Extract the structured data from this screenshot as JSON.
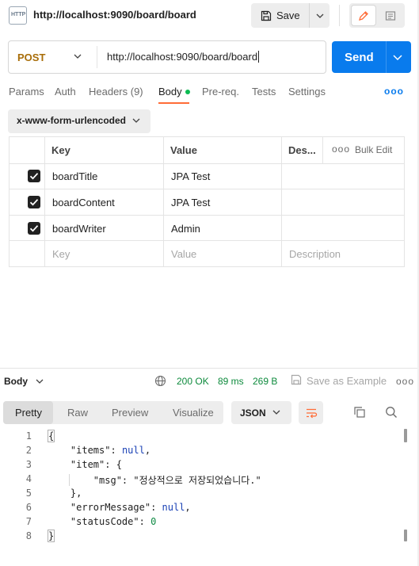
{
  "app": {
    "tab_icon_text": "HTTP",
    "tab_title": "http://localhost:9090/board/board",
    "save_label": "Save"
  },
  "request": {
    "method": "POST",
    "url": "http://localhost:9090/board/board",
    "send_label": "Send"
  },
  "request_tabs": [
    {
      "label": "Params"
    },
    {
      "label": "Auth"
    },
    {
      "label": "Headers (9)"
    },
    {
      "label": "Body",
      "active": true
    },
    {
      "label": "Pre-req."
    },
    {
      "label": "Tests"
    },
    {
      "label": "Settings"
    }
  ],
  "more_label": "ooo",
  "body_type": "x-www-form-urlencoded",
  "params_table": {
    "headers": {
      "key": "Key",
      "value": "Value",
      "description": "Des...",
      "bulk_edit": "Bulk Edit",
      "more": "ooo"
    },
    "rows": [
      {
        "checked": true,
        "key": "boardTitle",
        "value": "JPA Test",
        "description": ""
      },
      {
        "checked": true,
        "key": "boardContent",
        "value": "JPA Test",
        "description": ""
      },
      {
        "checked": true,
        "key": "boardWriter",
        "value": "Admin",
        "description": ""
      }
    ],
    "placeholder": {
      "key": "Key",
      "value": "Value",
      "description": "Description"
    }
  },
  "response": {
    "section_label": "Body",
    "status": "200 OK",
    "time": "89 ms",
    "size": "269 B",
    "save_example": "Save as Example",
    "more": "ooo",
    "view_tabs": [
      {
        "label": "Pretty",
        "active": true
      },
      {
        "label": "Raw"
      },
      {
        "label": "Preview"
      },
      {
        "label": "Visualize"
      }
    ],
    "format": "JSON",
    "line_numbers": [
      "1",
      "2",
      "3",
      "4",
      "5",
      "6",
      "7",
      "8"
    ],
    "code": {
      "l1": "{",
      "l2_key": "\"items\"",
      "l2_val": "null",
      "l3_key": "\"item\"",
      "l3_rest": ": {",
      "l4_key": "\"msg\"",
      "l4_val": "\"정상적으로 저장되었습니다.\"",
      "l5": "},",
      "l6_key": "\"errorMessage\"",
      "l6_val": "null",
      "l7_key": "\"statusCode\"",
      "l7_val": "0",
      "l8": "}"
    }
  },
  "colors": {
    "accent": "#ff6c37",
    "send": "#097bed",
    "method_post": "#a86d08",
    "status_ok": "#0d8a3c"
  }
}
